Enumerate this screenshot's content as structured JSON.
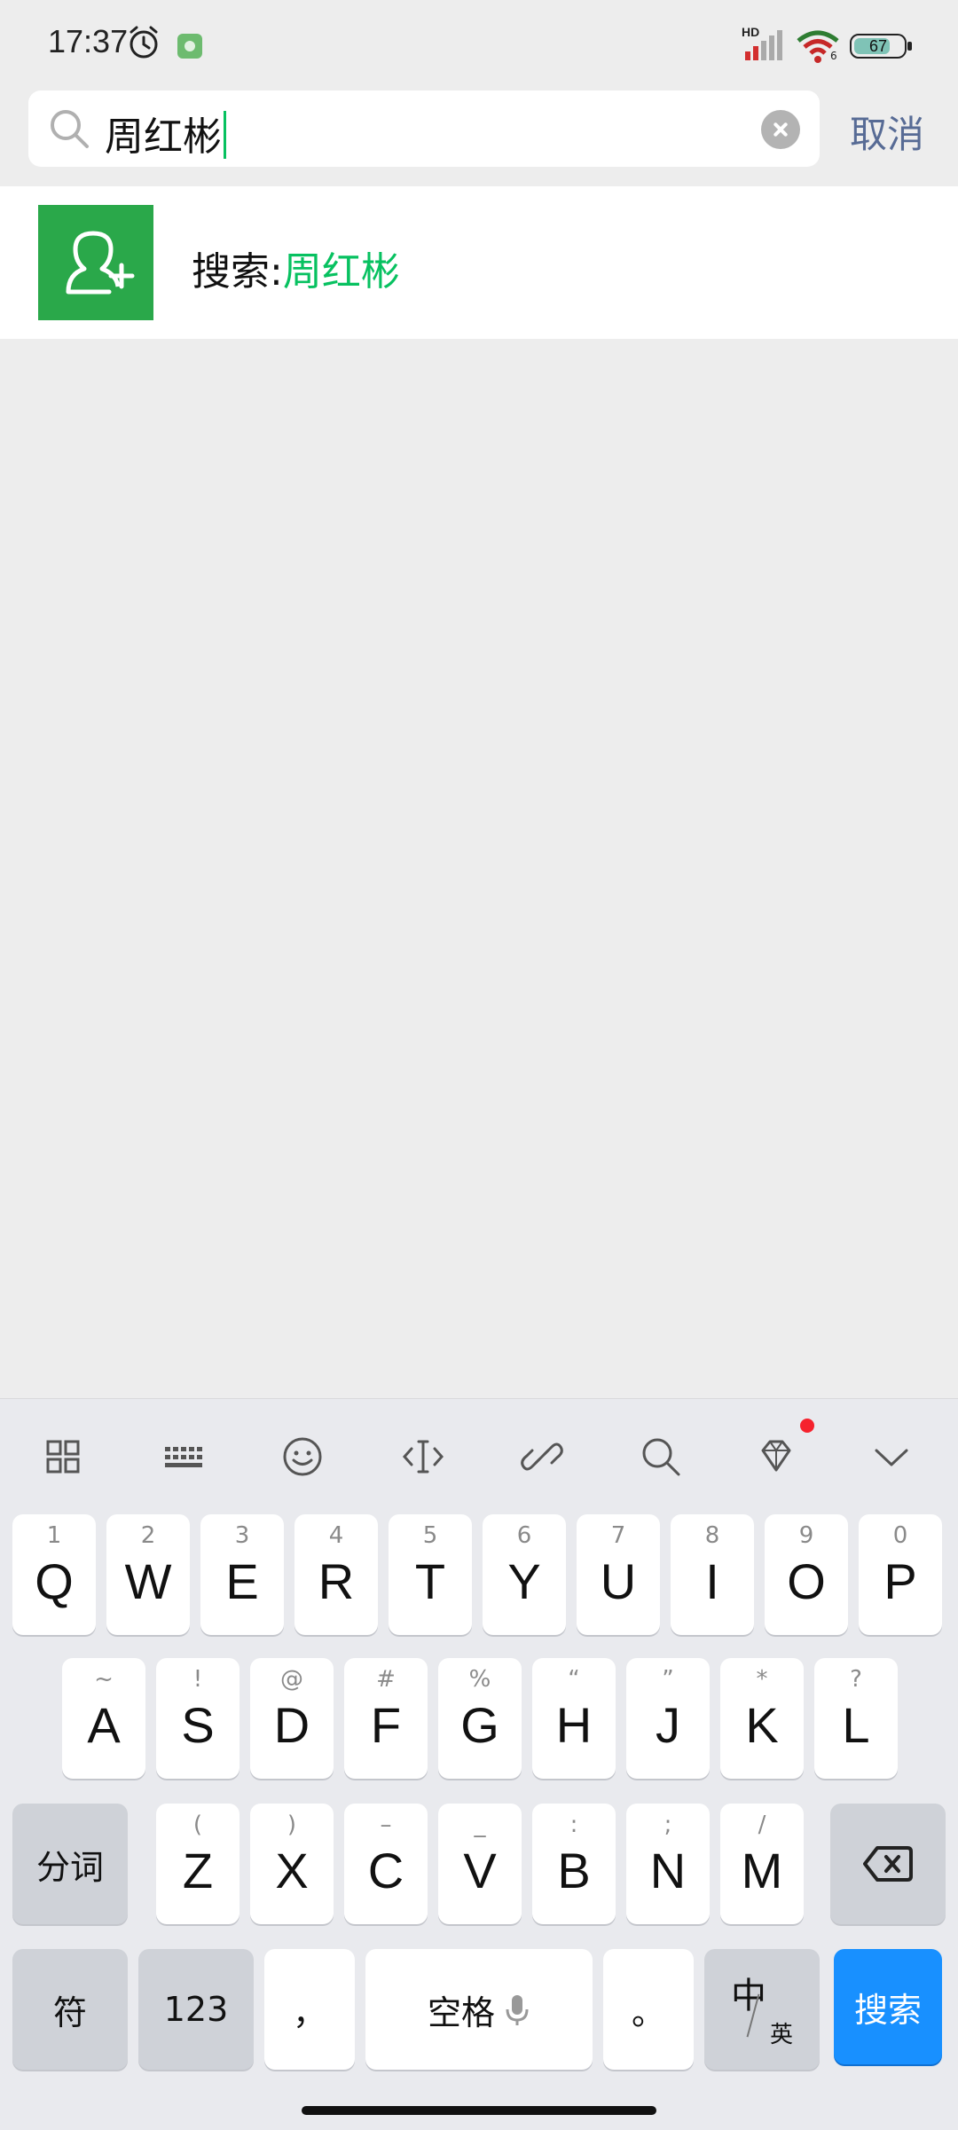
{
  "status_bar": {
    "time": "17:37",
    "network_label": "HD",
    "wifi_sub": "6",
    "battery_level": "67"
  },
  "search": {
    "query": "周红彬",
    "cancel_label": "取消"
  },
  "result": {
    "prefix": "搜索:",
    "keyword": "周红彬"
  },
  "keyboard": {
    "toolbar_icons": [
      "grid-icon",
      "keyboard-icon",
      "emoji-icon",
      "cursor-icon",
      "link-icon",
      "search-icon",
      "diamond-icon",
      "collapse-icon"
    ],
    "row1": [
      {
        "sub": "1",
        "main": "Q"
      },
      {
        "sub": "2",
        "main": "W"
      },
      {
        "sub": "3",
        "main": "E"
      },
      {
        "sub": "4",
        "main": "R"
      },
      {
        "sub": "5",
        "main": "T"
      },
      {
        "sub": "6",
        "main": "Y"
      },
      {
        "sub": "7",
        "main": "U"
      },
      {
        "sub": "8",
        "main": "I"
      },
      {
        "sub": "9",
        "main": "O"
      },
      {
        "sub": "0",
        "main": "P"
      }
    ],
    "row2": [
      {
        "sub": "~",
        "main": "A"
      },
      {
        "sub": "!",
        "main": "S"
      },
      {
        "sub": "@",
        "main": "D"
      },
      {
        "sub": "#",
        "main": "F"
      },
      {
        "sub": "%",
        "main": "G"
      },
      {
        "sub": "“",
        "main": "H"
      },
      {
        "sub": "”",
        "main": "J"
      },
      {
        "sub": "*",
        "main": "K"
      },
      {
        "sub": "?",
        "main": "L"
      }
    ],
    "row3": [
      {
        "sub": "(",
        "main": "Z"
      },
      {
        "sub": ")",
        "main": "X"
      },
      {
        "sub": "–",
        "main": "C"
      },
      {
        "sub": "_",
        "main": "V"
      },
      {
        "sub": ":",
        "main": "B"
      },
      {
        "sub": ";",
        "main": "N"
      },
      {
        "sub": "/",
        "main": "M"
      }
    ],
    "segment_label": "分词",
    "symbol_label": "符",
    "num_label": "123",
    "comma_label": "，",
    "space_label": "空格",
    "period_label": "。",
    "lang_zh": "中",
    "lang_en": "英",
    "search_label": "搜索"
  }
}
